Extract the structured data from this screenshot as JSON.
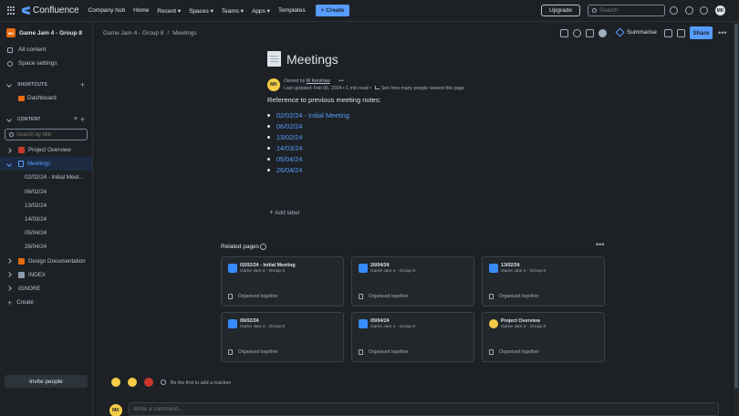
{
  "topnav": {
    "logo": "Confluence",
    "items": [
      "Company hub",
      "Home",
      "Recent ▾",
      "Spaces ▾",
      "Teams ▾",
      "Apps ▾",
      "Templates"
    ],
    "create": "+ Create",
    "upgrade": "Upgrade",
    "search_placeholder": "Search",
    "avatar": "MK"
  },
  "sidebar": {
    "space_initials": "MK",
    "space_name": "Game Jam 4 - Group 8",
    "all_content": "All content",
    "space_settings": "Space settings",
    "shortcuts_label": "SHORTCUTS",
    "dashboard": "Dashboard",
    "content_label": "CONTENT",
    "search_placeholder": "Search by title",
    "tree": [
      {
        "label": "Project Overview"
      },
      {
        "label": "Meetings"
      },
      {
        "label": "02/02/24 - Initial Meet..."
      },
      {
        "label": "06/02/24"
      },
      {
        "label": "13/02/24"
      },
      {
        "label": "14/03/24"
      },
      {
        "label": "05/04/24"
      },
      {
        "label": "26/04/24"
      },
      {
        "label": "Design Documentation"
      },
      {
        "label": "INDEX"
      },
      {
        "label": "IGNORE"
      },
      {
        "label": "Create"
      }
    ],
    "invite": "Invite people"
  },
  "breadcrumb": {
    "space": "Game Jam 4 - Group 8",
    "sep": "/",
    "page": "Meetings"
  },
  "toolbar": {
    "summarise": "Summarise",
    "share": "Share",
    "more": "•••"
  },
  "page": {
    "title": "Meetings",
    "owner_prefix": "Owned by",
    "owner": "M Kershaw",
    "byline_avatar": "MK",
    "last_updated": "Last updated: Feb 06, 2024  •  1 min read  •",
    "views": "See how many people viewed this page",
    "intro": "Reference to previous meeting notes:",
    "meetings": [
      "02/02/24 - Initial Meeting",
      "06/02/24",
      "13/02/24",
      "14/03/24",
      "05/04/24",
      "26/04/24"
    ],
    "add_label": "Add label"
  },
  "related": {
    "title": "Related pages",
    "more": "•••",
    "cards": [
      {
        "title": "02/02/24 - Initial Meeting",
        "space": "Game Jam 4 - Group 8",
        "foot": "Organised together"
      },
      {
        "title": "26/04/24",
        "space": "Game Jam 4 - Group 8",
        "foot": "Organised together"
      },
      {
        "title": "13/02/24",
        "space": "Game Jam 4 - Group 8",
        "foot": "Organised together"
      },
      {
        "title": "06/02/24",
        "space": "Game Jam 4 - Group 8",
        "foot": "Organised together"
      },
      {
        "title": "05/04/24",
        "space": "Game Jam 4 - Group 8",
        "foot": "Organised together"
      },
      {
        "title": "Project Overview",
        "space": "Game Jam 4 - Group 8",
        "foot": "Organised together"
      }
    ]
  },
  "reactions": {
    "prompt": "Be the first to add a reaction"
  },
  "comment": {
    "avatar": "MK",
    "placeholder": "Write a comment..."
  }
}
